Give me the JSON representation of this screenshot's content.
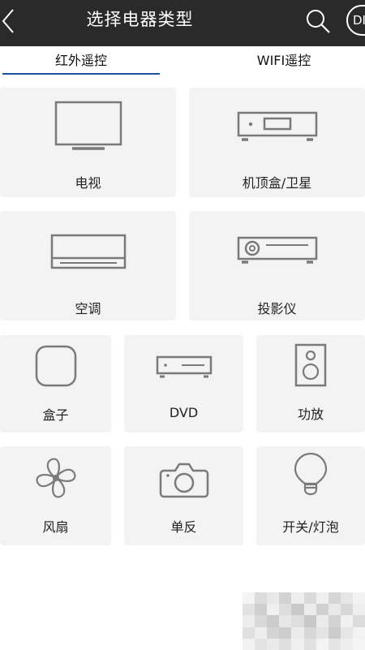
{
  "header": {
    "title": "选择电器类型",
    "diy_label": "DIY"
  },
  "tabs": [
    {
      "label": "红外遥控",
      "active": true
    },
    {
      "label": "WIFI遥控",
      "active": false
    }
  ],
  "devices": [
    {
      "label": "电视",
      "icon": "tv-icon"
    },
    {
      "label": "机顶盒/卫星",
      "icon": "set-top-box-icon"
    },
    {
      "label": "空调",
      "icon": "air-conditioner-icon"
    },
    {
      "label": "投影仪",
      "icon": "projector-icon"
    },
    {
      "label": "盒子",
      "icon": "media-box-icon"
    },
    {
      "label": "DVD",
      "icon": "dvd-player-icon"
    },
    {
      "label": "功放",
      "icon": "speaker-icon"
    },
    {
      "label": "风扇",
      "icon": "fan-icon"
    },
    {
      "label": "单反",
      "icon": "camera-icon"
    },
    {
      "label": "开关/灯泡",
      "icon": "light-bulb-icon"
    }
  ],
  "colors": {
    "header_bg": "#2a2a2a",
    "tile_bg": "#f3f3f3",
    "icon_stroke": "#7a7a7a",
    "tab_underline": "#1f4fa0"
  }
}
